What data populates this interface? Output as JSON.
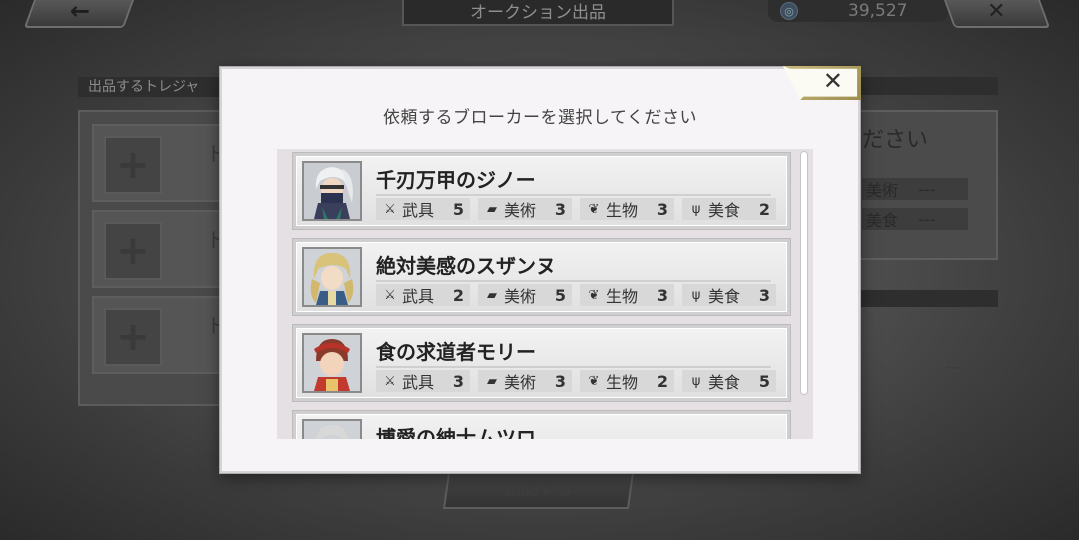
{
  "screen": {
    "title": "オークション出品",
    "currency_value": "39,527",
    "back_icon": "arrow-left",
    "close_icon": "x",
    "left_label": "出品するトレジャ",
    "left_slots": [
      {
        "text": "ト"
      },
      {
        "text": "ト"
      },
      {
        "text": "ト"
      }
    ],
    "right_title": "ださい",
    "right_rows": [
      {
        "label": "美術",
        "value": "---"
      },
      {
        "label": "美食",
        "value": "---"
      }
    ],
    "right_lower_value": "---",
    "submit_label": "出品する"
  },
  "modal": {
    "title": "依頼するブローカーを選択してください",
    "close_icon": "x",
    "stat_labels": [
      "武具",
      "美術",
      "生物",
      "美食"
    ],
    "brokers": [
      {
        "name": "千刃万甲のジノー",
        "stats": [
          "5",
          "3",
          "3",
          "2"
        ]
      },
      {
        "name": "絶対美感のスザンヌ",
        "stats": [
          "2",
          "5",
          "3",
          "3"
        ]
      },
      {
        "name": "食の求道者モリー",
        "stats": [
          "3",
          "3",
          "2",
          "5"
        ]
      },
      {
        "name": "博愛の紳士ムツロ",
        "stats": [
          "",
          "",
          "",
          ""
        ]
      }
    ]
  },
  "colors": {
    "modal_bg": "#f6f4f6",
    "gold_frame": "#b8a763",
    "stat_bg": "#d8d8d8"
  }
}
